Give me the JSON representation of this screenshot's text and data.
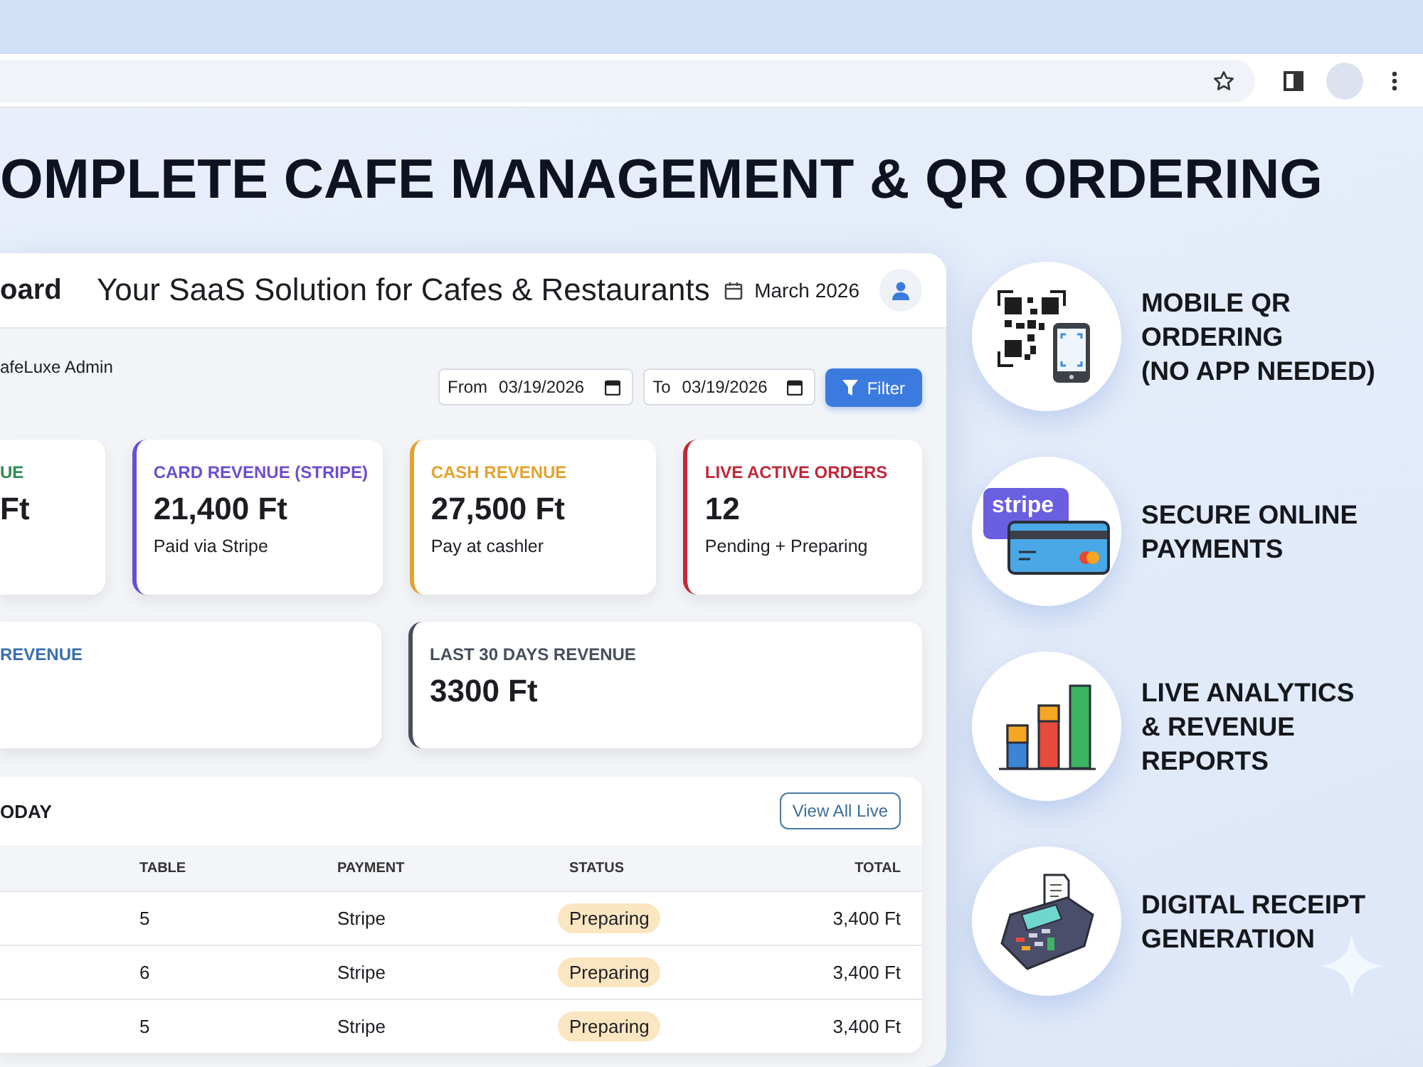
{
  "headline": "OMPLETE CAFE MANAGEMENT & QR ORDERING",
  "dashboard": {
    "header": {
      "title": "oard",
      "subtitle": "Your SaaS Solution for Cafes & Restaurants",
      "date": "March 2026"
    },
    "user": "afeLuxe Admin",
    "filter": {
      "from_label": "From",
      "from_value": "03/19/2026",
      "to_label": "To",
      "to_value": "03/19/2026",
      "button": "Filter"
    },
    "stat_cards": [
      {
        "label": "UE",
        "value": "Ft",
        "color": "#2f8a4f"
      },
      {
        "label": "CARD REVENUE (STRIPE)",
        "value": "21,400 Ft",
        "note": "Paid via Stripe",
        "color": "#6a4fd0"
      },
      {
        "label": "CASH REVENUE",
        "value": "27,500 Ft",
        "note": "Pay at cashler",
        "color": "#e3a22f"
      },
      {
        "label": "LIVE ACTIVE ORDERS",
        "value": "12",
        "note": "Pending + Preparing",
        "color": "#c0283a"
      }
    ],
    "wide_cards": [
      {
        "label": "REVENUE",
        "color": "#3a6fb0"
      },
      {
        "label": "LAST 30 DAYS REVENUE",
        "value": "3300 Ft",
        "color": "#474e5c"
      }
    ],
    "orders": {
      "title": "ODAY",
      "button": "View All Live",
      "columns": [
        "TABLE",
        "PAYMENT",
        "STATUS",
        "TOTAL"
      ],
      "rows": [
        {
          "table": "5",
          "payment": "Stripe",
          "status": "Preparing",
          "total": "3,400 Ft"
        },
        {
          "table": "6",
          "payment": "Stripe",
          "status": "Preparing",
          "total": "3,400 Ft"
        },
        {
          "table": "5",
          "payment": "Stripe",
          "status": "Preparing",
          "total": "3,400 Ft"
        }
      ]
    }
  },
  "features": [
    {
      "kind": "qr",
      "lines": [
        "MOBILE QR",
        "ORDERING",
        "(NO APP NEEDED)"
      ]
    },
    {
      "kind": "card",
      "badge": "stripe",
      "lines": [
        "SECURE ONLINE",
        "PAYMENTS"
      ]
    },
    {
      "kind": "chart",
      "lines": [
        "LIVE ANALYTICS",
        "& REVENUE",
        "REPORTS"
      ]
    },
    {
      "kind": "terminal",
      "lines": [
        "DIGITAL RECEIPT",
        "GENERATION"
      ]
    }
  ]
}
